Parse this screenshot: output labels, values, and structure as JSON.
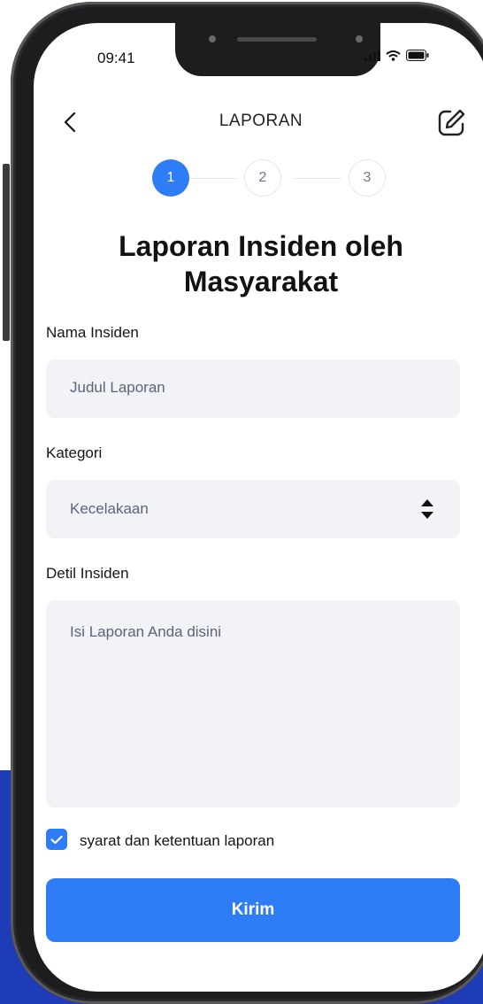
{
  "status_bar": {
    "time": "09:41"
  },
  "header": {
    "title": "LAPORAN"
  },
  "stepper": {
    "steps": [
      "1",
      "2",
      "3"
    ],
    "active_index": 0
  },
  "heading": {
    "line1": "Laporan Insiden oleh",
    "line2": "Masyarakat"
  },
  "form": {
    "incident_name": {
      "label": "Nama Insiden",
      "placeholder": "Judul Laporan"
    },
    "category": {
      "label": "Kategori",
      "value": "Kecelakaan"
    },
    "details": {
      "label": "Detil Insiden",
      "placeholder": "Isi Laporan Anda disini"
    },
    "terms": {
      "label": "syarat dan ketentuan laporan",
      "checked": true
    },
    "submit_label": "Kirim"
  },
  "colors": {
    "accent": "#2f7df6",
    "field_bg": "#f2f3f7",
    "backdrop": "#1e3bb8"
  }
}
